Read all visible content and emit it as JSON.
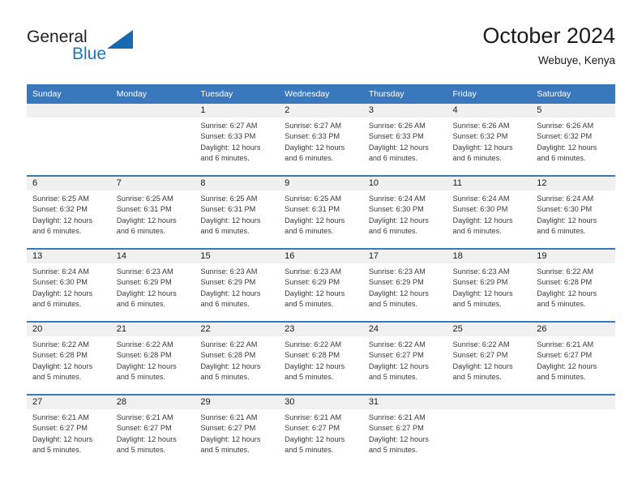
{
  "brand": {
    "name_part1": "General",
    "name_part2": "Blue",
    "mark": "triangle-logo"
  },
  "header": {
    "title": "October 2024",
    "subtitle": "Webuye, Kenya"
  },
  "colors": {
    "header_blue": "#3a78bd",
    "brand_blue": "#1668b0",
    "daynum_band": "#f0f0f0",
    "text": "#3a3a3a"
  },
  "weekdays": [
    "Sunday",
    "Monday",
    "Tuesday",
    "Wednesday",
    "Thursday",
    "Friday",
    "Saturday"
  ],
  "weeks": [
    [
      {
        "day": "",
        "sunrise": "",
        "sunset": "",
        "daylight1": "",
        "daylight2": ""
      },
      {
        "day": "",
        "sunrise": "",
        "sunset": "",
        "daylight1": "",
        "daylight2": ""
      },
      {
        "day": "1",
        "sunrise": "Sunrise: 6:27 AM",
        "sunset": "Sunset: 6:33 PM",
        "daylight1": "Daylight: 12 hours",
        "daylight2": "and 6 minutes."
      },
      {
        "day": "2",
        "sunrise": "Sunrise: 6:27 AM",
        "sunset": "Sunset: 6:33 PM",
        "daylight1": "Daylight: 12 hours",
        "daylight2": "and 6 minutes."
      },
      {
        "day": "3",
        "sunrise": "Sunrise: 6:26 AM",
        "sunset": "Sunset: 6:33 PM",
        "daylight1": "Daylight: 12 hours",
        "daylight2": "and 6 minutes."
      },
      {
        "day": "4",
        "sunrise": "Sunrise: 6:26 AM",
        "sunset": "Sunset: 6:32 PM",
        "daylight1": "Daylight: 12 hours",
        "daylight2": "and 6 minutes."
      },
      {
        "day": "5",
        "sunrise": "Sunrise: 6:26 AM",
        "sunset": "Sunset: 6:32 PM",
        "daylight1": "Daylight: 12 hours",
        "daylight2": "and 6 minutes."
      }
    ],
    [
      {
        "day": "6",
        "sunrise": "Sunrise: 6:25 AM",
        "sunset": "Sunset: 6:32 PM",
        "daylight1": "Daylight: 12 hours",
        "daylight2": "and 6 minutes."
      },
      {
        "day": "7",
        "sunrise": "Sunrise: 6:25 AM",
        "sunset": "Sunset: 6:31 PM",
        "daylight1": "Daylight: 12 hours",
        "daylight2": "and 6 minutes."
      },
      {
        "day": "8",
        "sunrise": "Sunrise: 6:25 AM",
        "sunset": "Sunset: 6:31 PM",
        "daylight1": "Daylight: 12 hours",
        "daylight2": "and 6 minutes."
      },
      {
        "day": "9",
        "sunrise": "Sunrise: 6:25 AM",
        "sunset": "Sunset: 6:31 PM",
        "daylight1": "Daylight: 12 hours",
        "daylight2": "and 6 minutes."
      },
      {
        "day": "10",
        "sunrise": "Sunrise: 6:24 AM",
        "sunset": "Sunset: 6:30 PM",
        "daylight1": "Daylight: 12 hours",
        "daylight2": "and 6 minutes."
      },
      {
        "day": "11",
        "sunrise": "Sunrise: 6:24 AM",
        "sunset": "Sunset: 6:30 PM",
        "daylight1": "Daylight: 12 hours",
        "daylight2": "and 6 minutes."
      },
      {
        "day": "12",
        "sunrise": "Sunrise: 6:24 AM",
        "sunset": "Sunset: 6:30 PM",
        "daylight1": "Daylight: 12 hours",
        "daylight2": "and 6 minutes."
      }
    ],
    [
      {
        "day": "13",
        "sunrise": "Sunrise: 6:24 AM",
        "sunset": "Sunset: 6:30 PM",
        "daylight1": "Daylight: 12 hours",
        "daylight2": "and 6 minutes."
      },
      {
        "day": "14",
        "sunrise": "Sunrise: 6:23 AM",
        "sunset": "Sunset: 6:29 PM",
        "daylight1": "Daylight: 12 hours",
        "daylight2": "and 6 minutes."
      },
      {
        "day": "15",
        "sunrise": "Sunrise: 6:23 AM",
        "sunset": "Sunset: 6:29 PM",
        "daylight1": "Daylight: 12 hours",
        "daylight2": "and 6 minutes."
      },
      {
        "day": "16",
        "sunrise": "Sunrise: 6:23 AM",
        "sunset": "Sunset: 6:29 PM",
        "daylight1": "Daylight: 12 hours",
        "daylight2": "and 5 minutes."
      },
      {
        "day": "17",
        "sunrise": "Sunrise: 6:23 AM",
        "sunset": "Sunset: 6:29 PM",
        "daylight1": "Daylight: 12 hours",
        "daylight2": "and 5 minutes."
      },
      {
        "day": "18",
        "sunrise": "Sunrise: 6:23 AM",
        "sunset": "Sunset: 6:29 PM",
        "daylight1": "Daylight: 12 hours",
        "daylight2": "and 5 minutes."
      },
      {
        "day": "19",
        "sunrise": "Sunrise: 6:22 AM",
        "sunset": "Sunset: 6:28 PM",
        "daylight1": "Daylight: 12 hours",
        "daylight2": "and 5 minutes."
      }
    ],
    [
      {
        "day": "20",
        "sunrise": "Sunrise: 6:22 AM",
        "sunset": "Sunset: 6:28 PM",
        "daylight1": "Daylight: 12 hours",
        "daylight2": "and 5 minutes."
      },
      {
        "day": "21",
        "sunrise": "Sunrise: 6:22 AM",
        "sunset": "Sunset: 6:28 PM",
        "daylight1": "Daylight: 12 hours",
        "daylight2": "and 5 minutes."
      },
      {
        "day": "22",
        "sunrise": "Sunrise: 6:22 AM",
        "sunset": "Sunset: 6:28 PM",
        "daylight1": "Daylight: 12 hours",
        "daylight2": "and 5 minutes."
      },
      {
        "day": "23",
        "sunrise": "Sunrise: 6:22 AM",
        "sunset": "Sunset: 6:28 PM",
        "daylight1": "Daylight: 12 hours",
        "daylight2": "and 5 minutes."
      },
      {
        "day": "24",
        "sunrise": "Sunrise: 6:22 AM",
        "sunset": "Sunset: 6:27 PM",
        "daylight1": "Daylight: 12 hours",
        "daylight2": "and 5 minutes."
      },
      {
        "day": "25",
        "sunrise": "Sunrise: 6:22 AM",
        "sunset": "Sunset: 6:27 PM",
        "daylight1": "Daylight: 12 hours",
        "daylight2": "and 5 minutes."
      },
      {
        "day": "26",
        "sunrise": "Sunrise: 6:21 AM",
        "sunset": "Sunset: 6:27 PM",
        "daylight1": "Daylight: 12 hours",
        "daylight2": "and 5 minutes."
      }
    ],
    [
      {
        "day": "27",
        "sunrise": "Sunrise: 6:21 AM",
        "sunset": "Sunset: 6:27 PM",
        "daylight1": "Daylight: 12 hours",
        "daylight2": "and 5 minutes."
      },
      {
        "day": "28",
        "sunrise": "Sunrise: 6:21 AM",
        "sunset": "Sunset: 6:27 PM",
        "daylight1": "Daylight: 12 hours",
        "daylight2": "and 5 minutes."
      },
      {
        "day": "29",
        "sunrise": "Sunrise: 6:21 AM",
        "sunset": "Sunset: 6:27 PM",
        "daylight1": "Daylight: 12 hours",
        "daylight2": "and 5 minutes."
      },
      {
        "day": "30",
        "sunrise": "Sunrise: 6:21 AM",
        "sunset": "Sunset: 6:27 PM",
        "daylight1": "Daylight: 12 hours",
        "daylight2": "and 5 minutes."
      },
      {
        "day": "31",
        "sunrise": "Sunrise: 6:21 AM",
        "sunset": "Sunset: 6:27 PM",
        "daylight1": "Daylight: 12 hours",
        "daylight2": "and 5 minutes."
      },
      {
        "day": "",
        "sunrise": "",
        "sunset": "",
        "daylight1": "",
        "daylight2": ""
      },
      {
        "day": "",
        "sunrise": "",
        "sunset": "",
        "daylight1": "",
        "daylight2": ""
      }
    ]
  ]
}
